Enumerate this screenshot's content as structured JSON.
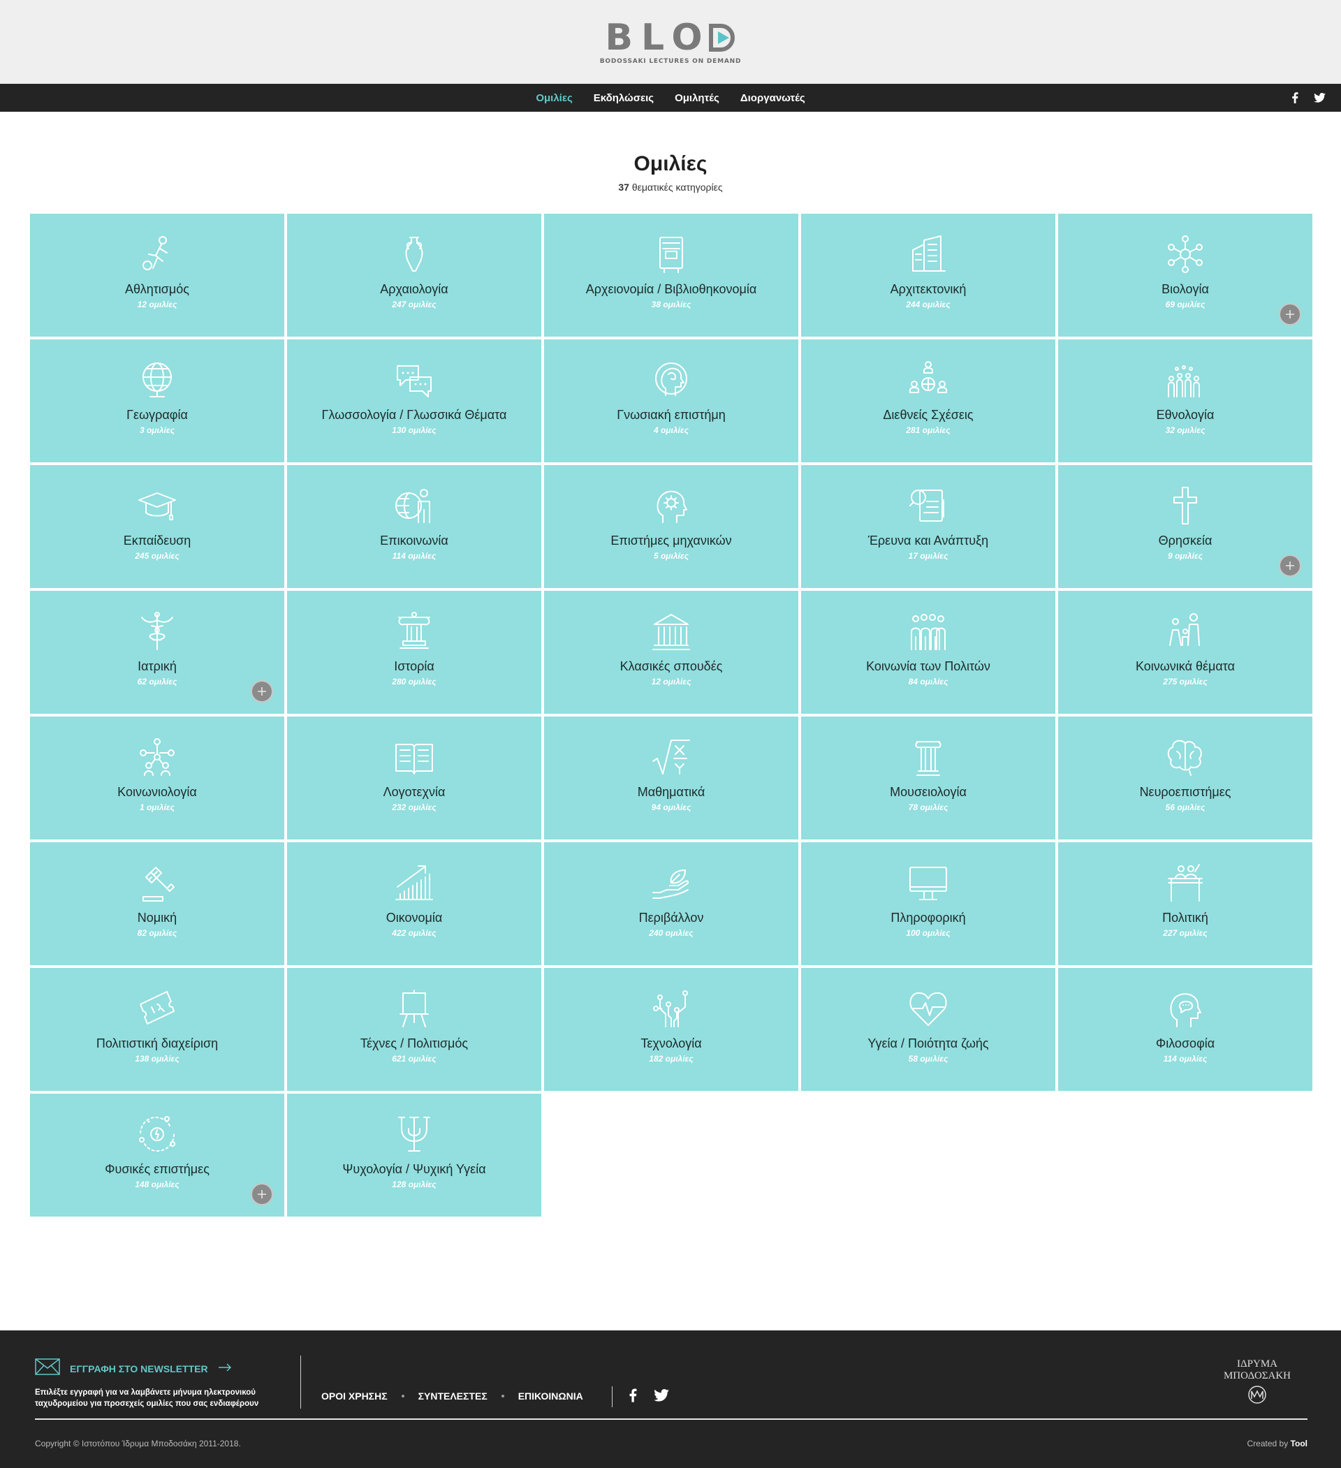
{
  "brand": {
    "logo_text": "BLOD",
    "logo_sub": "BODOSSAKI LECTURES ON DEMAND",
    "accent": "#62c7c7",
    "tile_color": "#93dede"
  },
  "nav": {
    "items": [
      {
        "label": "Ομιλίες",
        "active": true
      },
      {
        "label": "Εκδηλώσεις",
        "active": false
      },
      {
        "label": "Ομιλητές",
        "active": false
      },
      {
        "label": "Διοργανωτές",
        "active": false
      }
    ],
    "social": [
      "facebook-icon",
      "twitter-icon"
    ]
  },
  "page": {
    "title": "Ομιλίες",
    "count": "37",
    "count_label": "θεματικές κατηγορίες"
  },
  "categories": [
    {
      "name": "Αθλητισμός",
      "count": "12 ομιλίες",
      "icon": "runner-ball-icon",
      "plus": false
    },
    {
      "name": "Αρχαιολογία",
      "count": "247 ομιλίες",
      "icon": "amphora-icon",
      "plus": false
    },
    {
      "name": "Αρχειονομία / Βιβλιοθηκονομία",
      "count": "38 ομιλίες",
      "icon": "book-archive-icon",
      "plus": false
    },
    {
      "name": "Αρχιτεκτονική",
      "count": "244 ομιλίες",
      "icon": "buildings-icon",
      "plus": false
    },
    {
      "name": "Βιολογία",
      "count": "69 ομιλίες",
      "icon": "molecule-icon",
      "plus": true
    },
    {
      "name": "Γεωγραφία",
      "count": "3 ομιλίες",
      "icon": "globe-icon",
      "plus": false
    },
    {
      "name": "Γλωσσολογία / Γλωσσικά Θέματα",
      "count": "130 ομιλίες",
      "icon": "speech-bubbles-icon",
      "plus": false
    },
    {
      "name": "Γνωσιακή επιστήμη",
      "count": "4 ομιλίες",
      "icon": "head-brain-icon",
      "plus": false
    },
    {
      "name": "Διεθνείς Σχέσεις",
      "count": "281 ομιλίες",
      "icon": "people-globe-icon",
      "plus": false
    },
    {
      "name": "Εθνολογία",
      "count": "32 ομιλίες",
      "icon": "crowd-icon",
      "plus": false
    },
    {
      "name": "Εκπαίδευση",
      "count": "245 ομιλίες",
      "icon": "graduation-cap-icon",
      "plus": false
    },
    {
      "name": "Επικοινωνία",
      "count": "114 ομιλίες",
      "icon": "globe-person-icon",
      "plus": false
    },
    {
      "name": "Επιστήμες μηχανικών",
      "count": "5 ομιλίες",
      "icon": "head-gear-icon",
      "plus": false
    },
    {
      "name": "Έρευνα και Ανάπτυξη",
      "count": "17 ομιλίες",
      "icon": "magnifier-document-icon",
      "plus": false
    },
    {
      "name": "Θρησκεία",
      "count": "9 ομιλίες",
      "icon": "cross-icon",
      "plus": true
    },
    {
      "name": "Ιατρική",
      "count": "62 ομιλίες",
      "icon": "caduceus-icon",
      "plus": true
    },
    {
      "name": "Ιστορία",
      "count": "280 ομιλίες",
      "icon": "column-capital-icon",
      "plus": false
    },
    {
      "name": "Κλασικές σπουδές",
      "count": "12 ομιλίες",
      "icon": "temple-icon",
      "plus": false
    },
    {
      "name": "Κοινωνία των Πολιτών",
      "count": "84 ομιλίες",
      "icon": "citizens-icon",
      "plus": false
    },
    {
      "name": "Κοινωνικά θέματα",
      "count": "275 ομιλίες",
      "icon": "family-icon",
      "plus": false
    },
    {
      "name": "Κοινωνιολογία",
      "count": "1 ομιλίες",
      "icon": "network-people-icon",
      "plus": false
    },
    {
      "name": "Λογοτεχνία",
      "count": "232 ομιλίες",
      "icon": "open-book-icon",
      "plus": false
    },
    {
      "name": "Μαθηματικά",
      "count": "94 ομιλίες",
      "icon": "square-root-icon",
      "plus": false
    },
    {
      "name": "Μουσειολογία",
      "count": "78 ομιλίες",
      "icon": "ionic-column-icon",
      "plus": false
    },
    {
      "name": "Νευροεπιστήμες",
      "count": "56 ομιλίες",
      "icon": "brain-icon",
      "plus": false
    },
    {
      "name": "Νομική",
      "count": "82 ομιλίες",
      "icon": "gavel-icon",
      "plus": false
    },
    {
      "name": "Οικονομία",
      "count": "422 ομιλίες",
      "icon": "growth-chart-icon",
      "plus": false
    },
    {
      "name": "Περιβάλλον",
      "count": "240 ομιλίες",
      "icon": "hand-leaf-icon",
      "plus": false
    },
    {
      "name": "Πληροφορική",
      "count": "100 ομιλίες",
      "icon": "monitor-icon",
      "plus": false
    },
    {
      "name": "Πολιτική",
      "count": "227 ομιλίες",
      "icon": "podium-icon",
      "plus": false
    },
    {
      "name": "Πολιτιστική διαχείριση",
      "count": "138 ομιλίες",
      "icon": "ticket-icon",
      "plus": false
    },
    {
      "name": "Τέχνες / Πολιτισμός",
      "count": "621 ομιλίες",
      "icon": "easel-icon",
      "plus": false
    },
    {
      "name": "Τεχνολογία",
      "count": "182 ομιλίες",
      "icon": "circuit-icon",
      "plus": false
    },
    {
      "name": "Υγεία / Ποιότητα ζωής",
      "count": "58 ομιλίες",
      "icon": "heartbeat-icon",
      "plus": false
    },
    {
      "name": "Φιλοσοφία",
      "count": "114 ομιλίες",
      "icon": "head-thought-icon",
      "plus": false
    },
    {
      "name": "Φυσικές επιστήμες",
      "count": "148 ομιλίες",
      "icon": "orbit-icon",
      "plus": true
    },
    {
      "name": "Ψυχολογία / Ψυχική Υγεία",
      "count": "128 ομιλίες",
      "icon": "psi-icon",
      "plus": false
    }
  ],
  "footer": {
    "newsletter_title": "ΕΓΓΡΑΦΗ ΣΤΟ NEWSLETTER",
    "newsletter_text": "Επιλέξτε εγγραφή για να λαμβάνετε μήνυμα ηλεκτρονικού ταχυδρομείου για προσεχείς ομιλίες που σας ενδιαφέρουν",
    "links": [
      "ΟΡΟΙ ΧΡΗΣΗΣ",
      "ΣΥΝΤΕΛΕΣΤΕΣ",
      "ΕΠΙΚΟΙΝΩΝΙΑ"
    ],
    "foundation_line1": "ΙΔΡΥΜΑ",
    "foundation_line2": "ΜΠΟΔΟΣΑΚΗ",
    "copyright": "Copyright © Ιστοτόπου Ίδρυμα Μποδοσάκη 2011-2018.",
    "created_by": "Created by",
    "creator": "Tool"
  }
}
